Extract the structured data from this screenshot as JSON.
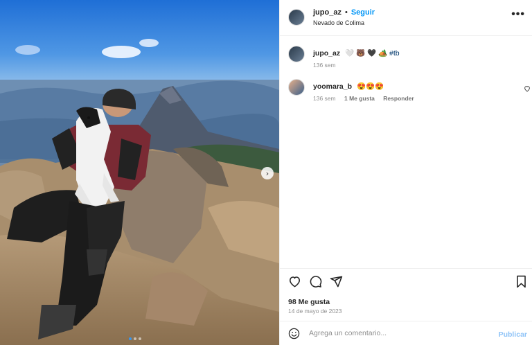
{
  "post": {
    "author": "jupo_az",
    "separator": "•",
    "follow_label": "Seguir",
    "location": "Nevado de Colima",
    "more_icon": "more-options-icon",
    "more_glyph": "•••"
  },
  "photo": {
    "description": "man with dog on mountain summit",
    "carousel_next_glyph": "›",
    "dots": 3,
    "active_dot": 0
  },
  "comments": [
    {
      "username": "jupo_az",
      "text": "🤍 🐻 🖤 🏕️",
      "hashtag": "#tb",
      "time": "136 sem"
    },
    {
      "username": "yoomara_b",
      "text": "😍😍😍",
      "time": "136 sem",
      "likes": "1 Me gusta",
      "reply": "Responder"
    }
  ],
  "actions": {
    "likes": "98 Me gusta",
    "date": "14 de mayo de 2023"
  },
  "add_comment": {
    "placeholder": "Agrega un comentario...",
    "publish_label": "Publicar"
  },
  "colors": {
    "accent": "#0095f6",
    "publish_disabled": "#8ec3f7",
    "muted": "#8e8e8e"
  }
}
